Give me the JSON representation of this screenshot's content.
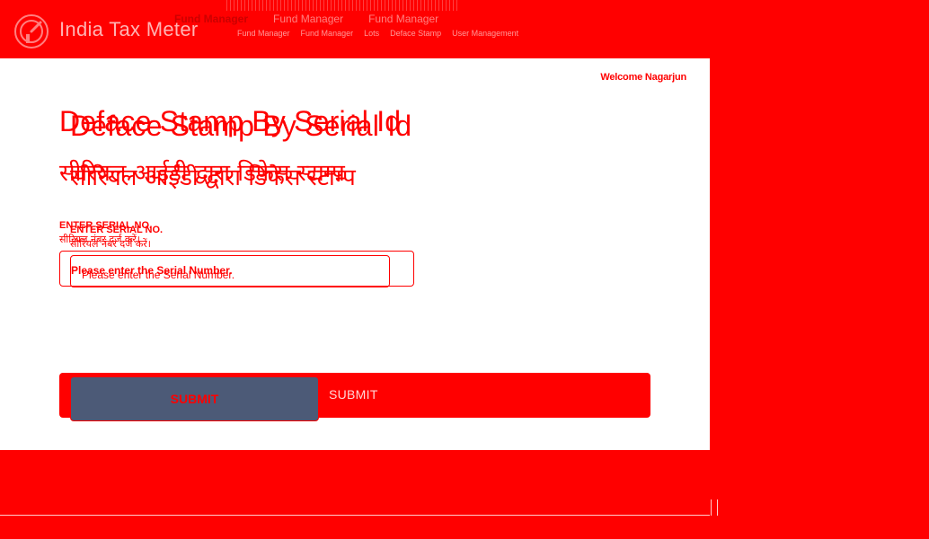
{
  "header": {
    "app_title": "India Tax Meter",
    "logo_icon": "meter-logo-icon",
    "nav_top": [
      "Fund Manager",
      "",
      "Fund Manager",
      "",
      "Fund Manager"
    ],
    "nav_sub": [
      "Fund Manager",
      "Fund Manager",
      "Lots",
      "Deface Stamp",
      "User Management"
    ]
  },
  "main": {
    "welcome": "Welcome Nagarjun",
    "title_en": "Deface Stamp By Serial Id",
    "title_hi": "सीरियल आईडी द्वारा डिफेस स्टाम्प",
    "field": {
      "label_en": "ENTER SERIAL NO.",
      "label_hi": "सीरियल नंबर दर्ज करें।",
      "placeholder": "Please enter the Serial Number."
    },
    "submit_label": "SUBMIT"
  },
  "colors": {
    "background": "#ff0000",
    "panel": "#ffffff",
    "button": "#4c5a77"
  }
}
